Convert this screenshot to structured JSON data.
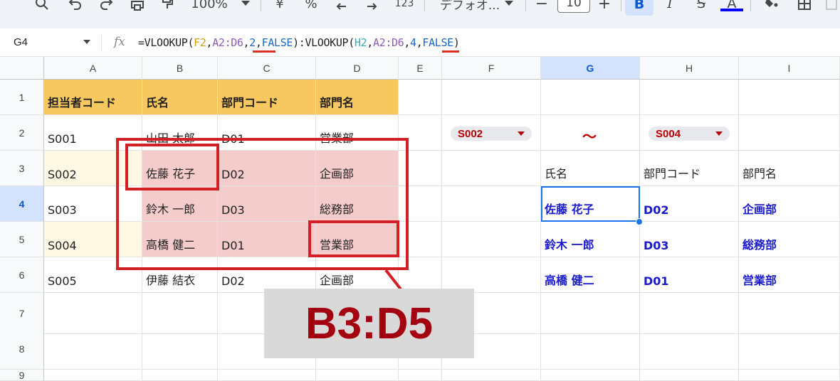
{
  "toolbar": {
    "zoom_label": "100%",
    "currency_label": "¥",
    "percent_label": "%",
    "number_format_label": "123",
    "font_label": "デフォオ...",
    "font_size": "10",
    "minus_label": "−",
    "plus_label": "+",
    "bold_label": "B",
    "italic_label": "I",
    "strike_label": "S",
    "text_color_label": "A",
    "icons": [
      "search-icon",
      "undo-icon",
      "redo-icon",
      "print-icon",
      "paint-format-icon",
      "zoom-dropdown-icon",
      "decimal-decrease-icon",
      "decimal-increase-icon",
      "fill-color-icon",
      "borders-icon"
    ]
  },
  "formula_bar": {
    "cell_ref": "G4",
    "fx_label": "fx",
    "formula_parts": [
      {
        "text": "=VLOOKUP(",
        "color": "default"
      },
      {
        "text": "F2",
        "color": "orange"
      },
      {
        "text": ",",
        "color": "default"
      },
      {
        "text": "A2:D6",
        "color": "purple"
      },
      {
        "text": ",",
        "color": "default"
      },
      {
        "text": "2",
        "color": "blue"
      },
      {
        "text": ",",
        "color": "default"
      },
      {
        "text": "FALSE",
        "color": "blue"
      },
      {
        "text": "):VLOOKUP(",
        "color": "default"
      },
      {
        "text": "H2",
        "color": "teal"
      },
      {
        "text": ",",
        "color": "default"
      },
      {
        "text": "A2:D6",
        "color": "purple"
      },
      {
        "text": ",",
        "color": "default"
      },
      {
        "text": "4",
        "color": "blue"
      },
      {
        "text": ",",
        "color": "default"
      },
      {
        "text": "FALSE",
        "color": "blue"
      },
      {
        "text": ")",
        "color": "default"
      }
    ]
  },
  "columns": [
    "A",
    "B",
    "C",
    "D",
    "E",
    "F",
    "G",
    "H",
    "I"
  ],
  "rows": [
    "1",
    "2",
    "3",
    "4",
    "5",
    "6",
    "7",
    "8",
    "9"
  ],
  "selected": {
    "column": "G",
    "row": "4"
  },
  "table": {
    "headers": [
      "担当者コード",
      "氏名",
      "部門コード",
      "部門名"
    ],
    "rows": [
      [
        "S001",
        "山田 太郎",
        "D01",
        "営業部"
      ],
      [
        "S002",
        "佐藤 花子",
        "D02",
        "企画部"
      ],
      [
        "S003",
        "鈴木 一郎",
        "D03",
        "総務部"
      ],
      [
        "S004",
        "高橋 健二",
        "D01",
        "営業部"
      ],
      [
        "S005",
        "伊藤 結衣",
        "D02",
        "企画部"
      ]
    ]
  },
  "range_picker": {
    "from": "S002",
    "separator": "〜",
    "to": "S004"
  },
  "result": {
    "headers": [
      "氏名",
      "部門コード",
      "部門名"
    ],
    "rows": [
      [
        "佐藤 花子",
        "D02",
        "企画部"
      ],
      [
        "鈴木 一郎",
        "D03",
        "総務部"
      ],
      [
        "高橋 健二",
        "D01",
        "営業部"
      ]
    ]
  },
  "callout": {
    "label": "B3:D5"
  },
  "colors": {
    "header_fill": "#f6c85f",
    "highlight_fill": "#f4cccc",
    "cream_fill": "#fff8e4",
    "annotation_red": "#d32027",
    "result_text": "#1a1acd",
    "chip_text": "#b80000"
  }
}
